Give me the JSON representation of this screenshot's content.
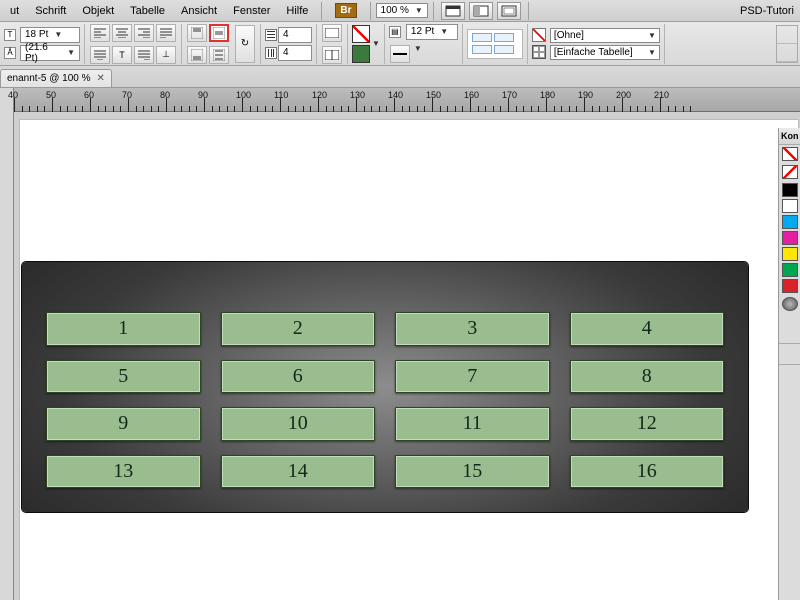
{
  "menu": {
    "items": [
      "ut",
      "Schrift",
      "Objekt",
      "Tabelle",
      "Ansicht",
      "Fenster",
      "Hilfe"
    ],
    "br": "Br",
    "zoom": "100 %",
    "app_title": "PSD-Tutori"
  },
  "ctrl": {
    "font_size": "18 Pt",
    "leading": "(21.6 Pt)",
    "cols": "4",
    "cols2": "4",
    "stroke": "12 Pt",
    "style_none": "[Ohne]",
    "style_simple": "[Einfache Tabelle]"
  },
  "doc_tab": {
    "label": "enannt-5 @ 100 %"
  },
  "ruler_start": 40,
  "ruler_step": 10,
  "ruler_count": 17,
  "cells": [
    "1",
    "2",
    "3",
    "4",
    "5",
    "6",
    "7",
    "8",
    "9",
    "10",
    "11",
    "12",
    "13",
    "14",
    "15",
    "16"
  ],
  "swatches": [
    "#000000",
    "#ffffff",
    "#00aaee",
    "#e61ea1",
    "#ffe600",
    "#00a64f",
    "#d8232a"
  ],
  "panel_title": "Kon"
}
